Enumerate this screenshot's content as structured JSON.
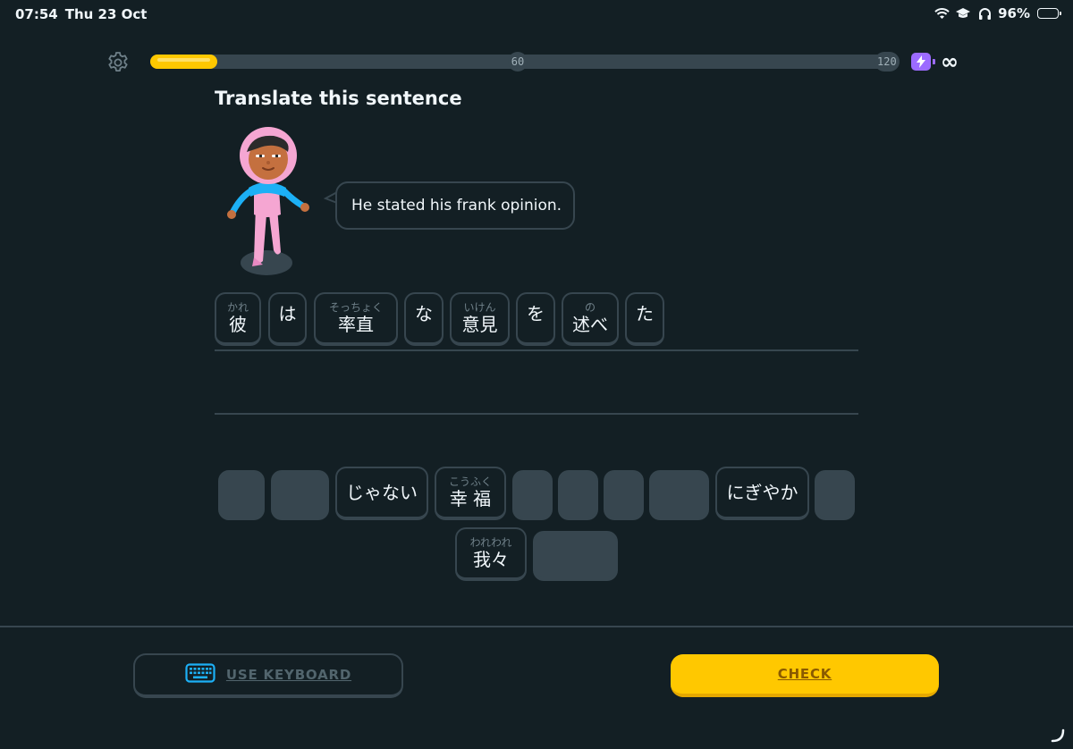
{
  "status_bar": {
    "time": "07:54",
    "date": "Thu 23 Oct",
    "battery": "96%",
    "icons": [
      "wifi-icon",
      "graduation-cap-icon",
      "headphones-icon",
      "battery-icon"
    ]
  },
  "progress": {
    "fraction": 0.09,
    "milestones": [
      "60",
      "120"
    ],
    "energy_value": "∞"
  },
  "lesson": {
    "title": "Translate this sentence",
    "prompt": "He stated his frank opinion."
  },
  "answer_tiles": [
    {
      "furigana": "かれ",
      "word": "彼"
    },
    {
      "furigana": "",
      "word": "は"
    },
    {
      "furigana": "そっちょく",
      "word": "率直"
    },
    {
      "furigana": "",
      "word": "な"
    },
    {
      "furigana": "いけん",
      "word": "意見"
    },
    {
      "furigana": "",
      "word": "を"
    },
    {
      "furigana": "の",
      "word": "述べ"
    },
    {
      "furigana": "",
      "word": "た"
    }
  ],
  "word_bank": [
    {
      "furigana": "",
      "word": "じゃない"
    },
    {
      "furigana": "こうふく",
      "word": "幸 福"
    },
    {
      "furigana": "",
      "word": "にぎやか"
    },
    {
      "furigana": "われわれ",
      "word": "我々"
    }
  ],
  "footer": {
    "keyboard_label": "USE KEYBOARD",
    "check_label": "CHECK"
  },
  "colors": {
    "background": "#131f24",
    "border": "#37464f",
    "progress": "#ffc800",
    "check": "#ffc800",
    "energy": "#9c6bff",
    "keyboard_icon": "#1cb0f6"
  }
}
